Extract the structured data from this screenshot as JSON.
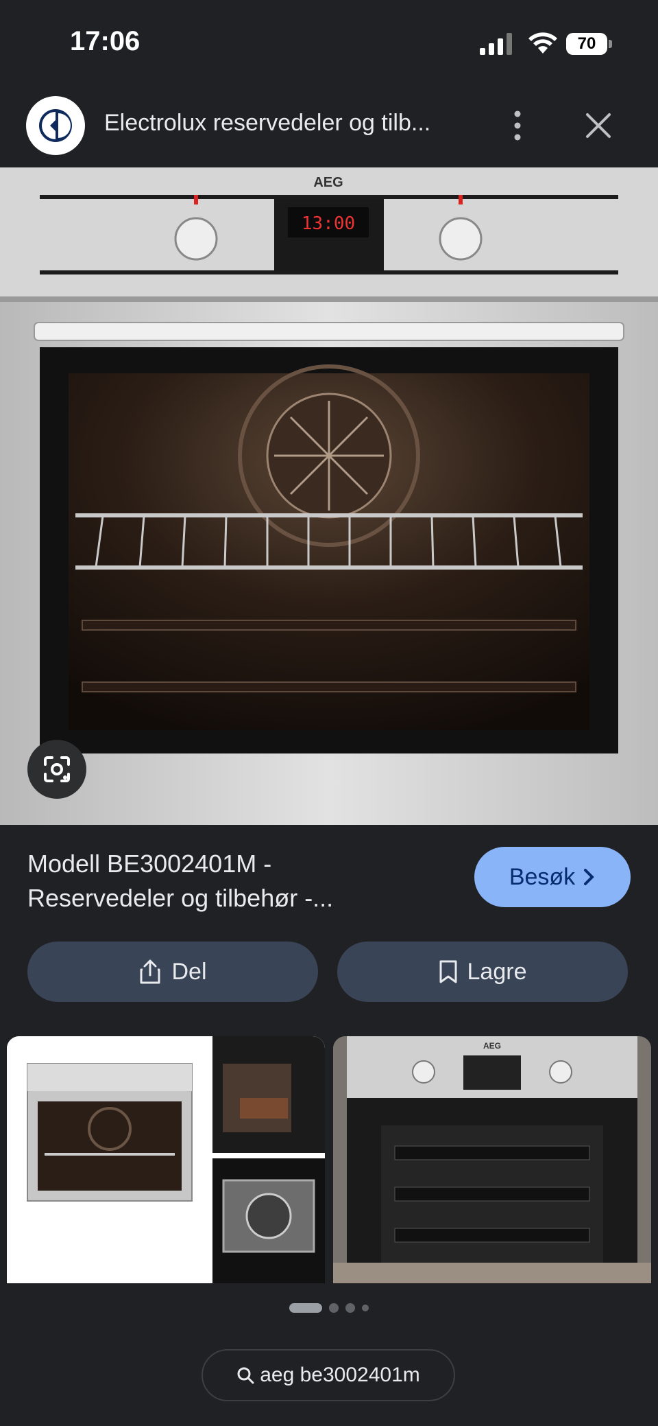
{
  "status_bar": {
    "time": "17:06",
    "battery": "70"
  },
  "header": {
    "title": "Electrolux reservedeler og tilb..."
  },
  "main_image": {
    "brand": "AEG",
    "display": "13:00"
  },
  "result": {
    "title_line1": "Modell BE3002401M -",
    "title_line2": "Reservedeler og tilbehør -...",
    "visit_label": "Besøk"
  },
  "actions": {
    "share_label": "Del",
    "save_label": "Lagre"
  },
  "related": {
    "right_brand": "AEG"
  },
  "search": {
    "query": "aeg be3002401m"
  },
  "pagination": {
    "active_index": 0,
    "count": 4
  },
  "colors": {
    "background": "#202124",
    "accent": "#8ab4f8",
    "button": "#394457"
  },
  "icons": [
    "signal-icon",
    "wifi-icon",
    "battery-icon",
    "electrolux-logo-icon",
    "more-vert-icon",
    "close-icon",
    "lens-icon",
    "share-icon",
    "bookmark-icon",
    "chevron-right-icon",
    "search-icon"
  ]
}
